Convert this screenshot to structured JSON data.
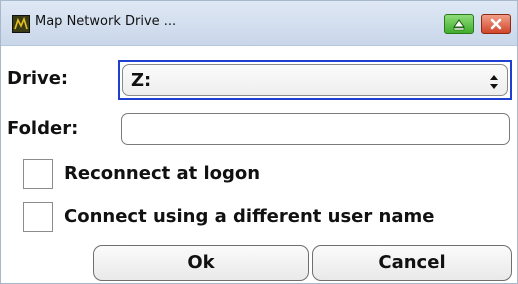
{
  "window": {
    "title": "Map Network Drive ...",
    "minimize_icon": "minimize-icon",
    "close_icon": "close-icon",
    "app_icon": "app-icon"
  },
  "drive": {
    "label": "Drive:",
    "value": "Z:",
    "icon": "updown-arrows-icon"
  },
  "folder": {
    "label": "Folder:",
    "value": "",
    "placeholder": ""
  },
  "options": {
    "reconnect_label": "Reconnect at logon",
    "reconnect_checked": false,
    "different_user_label": "Connect using a different user name",
    "different_user_checked": false
  },
  "buttons": {
    "ok_label": "Ok",
    "cancel_label": "Cancel"
  },
  "colors": {
    "focus_border": "#1f3fd0",
    "minimize_green": "#3fae2c",
    "close_red": "#d0462a"
  }
}
